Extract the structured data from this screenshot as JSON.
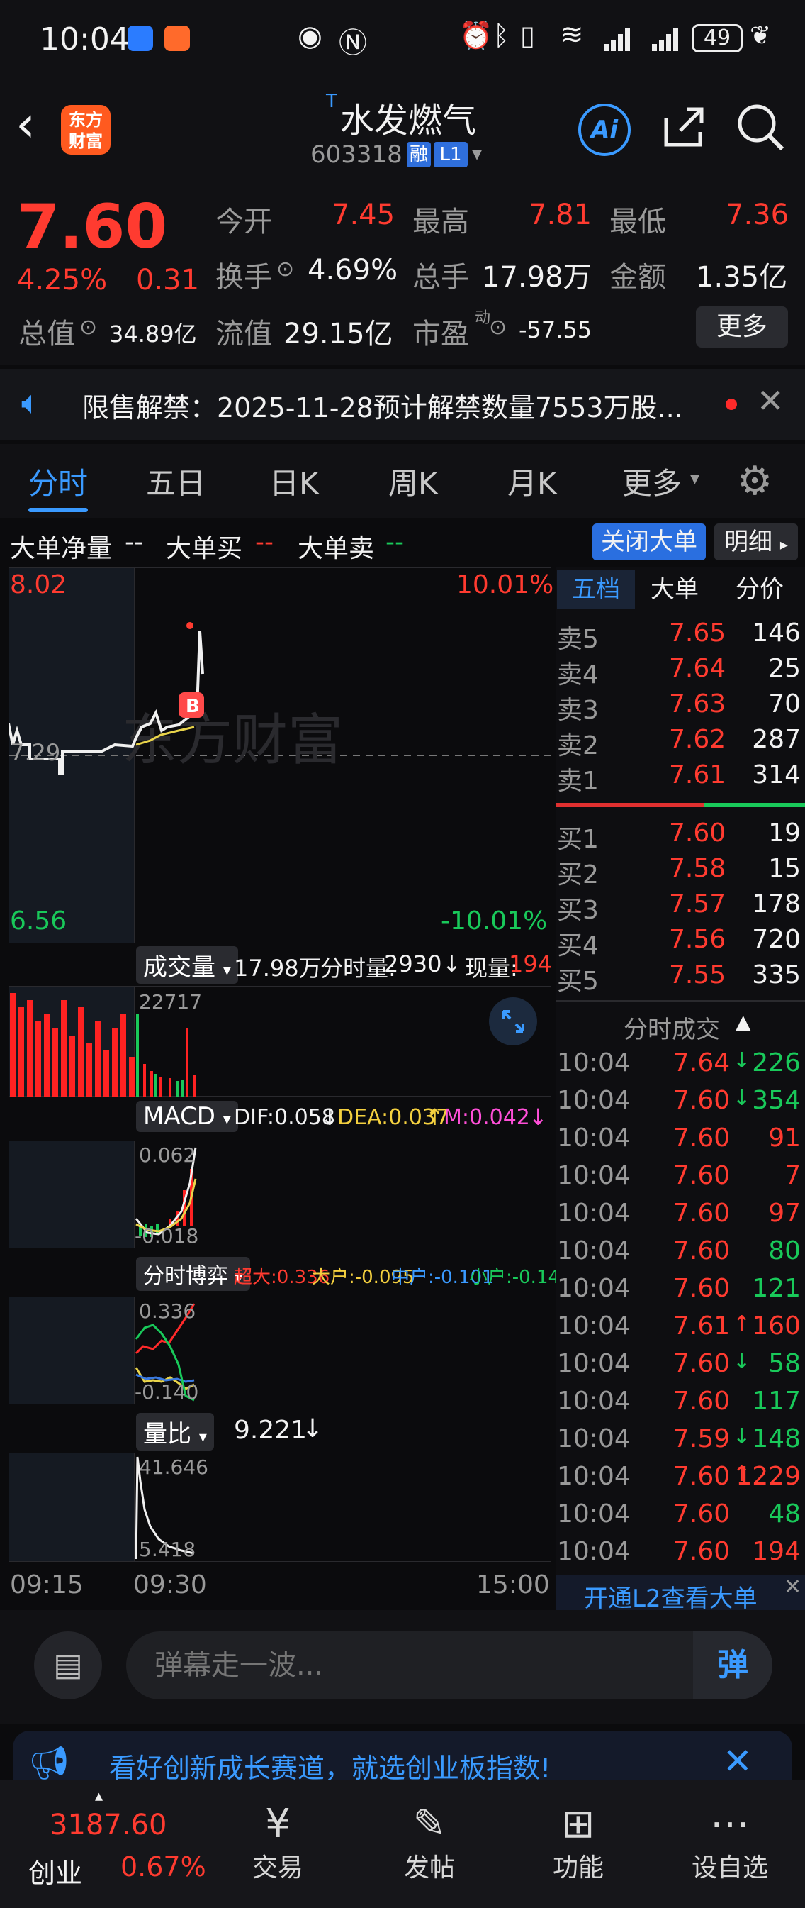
{
  "status_bar": {
    "time": "10:04",
    "battery": "49"
  },
  "header": {
    "logo_line1": "东方",
    "logo_line2": "财富",
    "title_prefix": "T",
    "title": "水发燃气",
    "code": "603318",
    "tag_margin": "融",
    "tag_level": "L1",
    "ai_label": "Ai"
  },
  "quote": {
    "price": "7.60",
    "change_pct": "4.25%",
    "change_amt": "0.31",
    "open_label": "今开",
    "open": "7.45",
    "high_label": "最高",
    "high": "7.81",
    "low_label": "最低",
    "low": "7.36",
    "turnover_label": "换手",
    "turnover": "4.69%",
    "volume_label": "总手",
    "volume": "17.98万",
    "amount_label": "金额",
    "amount": "1.35亿",
    "mktcap_label": "总值",
    "mktcap": "34.89亿",
    "float_label": "流值",
    "float": "29.15亿",
    "pe_label": "市盈",
    "pe_sup": "动",
    "pe": "-57.55",
    "more_button": "更多"
  },
  "notice": {
    "text": "限售解禁：2025-11-28预计解禁数量7553万股..."
  },
  "tabs": [
    {
      "label": "分时",
      "active": true
    },
    {
      "label": "五日",
      "active": false
    },
    {
      "label": "日K",
      "active": false
    },
    {
      "label": "周K",
      "active": false
    },
    {
      "label": "月K",
      "active": false
    },
    {
      "label": "更多",
      "active": false
    }
  ],
  "big_orders": {
    "net_label": "大单净量",
    "net_value": "--",
    "buy_label": "大单买",
    "buy_value": "--",
    "sell_label": "大单卖",
    "sell_value": "--",
    "close_button": "关闭大单",
    "detail_button": "明细"
  },
  "price_chart": {
    "top_price": "8.02",
    "top_pct": "10.01%",
    "mid_price": "7.29",
    "bottom_price": "6.56",
    "bottom_pct": "-10.01%",
    "watermark": "东方财富",
    "marker": "B"
  },
  "volume_panel": {
    "label": "成交量",
    "total": "17.98万",
    "minute_label": "分时量:",
    "minute_value": "2930",
    "now_label": "现量:",
    "now_value": "194",
    "axis_top": "22717"
  },
  "macd_panel": {
    "label": "MACD",
    "dif": "DIF:0.058",
    "dea": "DEA:0.037",
    "m": "M:0.042",
    "axis_top": "0.062",
    "axis_bottom": "-0.018"
  },
  "game_panel": {
    "label": "分时博弈",
    "super": "超大:0.336",
    "big": "大户:-0.095",
    "mid": "中户:-0.101",
    "small": "小户:-0.140",
    "axis_top": "0.336",
    "axis_bottom": "-0.140"
  },
  "ratio_panel": {
    "label": "量比",
    "value": "9.221",
    "axis_top": "41.646",
    "axis_bottom": "5.418"
  },
  "time_axis": {
    "start": "09:15",
    "mid": "09:30",
    "end": "15:00"
  },
  "orderbook": {
    "tabs": [
      "五档",
      "大单",
      "分价"
    ],
    "sells": [
      {
        "label": "卖5",
        "price": "7.65",
        "vol": "146"
      },
      {
        "label": "卖4",
        "price": "7.64",
        "vol": "25"
      },
      {
        "label": "卖3",
        "price": "7.63",
        "vol": "70"
      },
      {
        "label": "卖2",
        "price": "7.62",
        "vol": "287"
      },
      {
        "label": "卖1",
        "price": "7.61",
        "vol": "314"
      }
    ],
    "buys": [
      {
        "label": "买1",
        "price": "7.60",
        "vol": "19"
      },
      {
        "label": "买2",
        "price": "7.58",
        "vol": "15"
      },
      {
        "label": "买3",
        "price": "7.57",
        "vol": "178"
      },
      {
        "label": "买4",
        "price": "7.56",
        "vol": "720"
      },
      {
        "label": "买5",
        "price": "7.55",
        "vol": "335"
      }
    ]
  },
  "trades": {
    "title": "分时成交",
    "rows": [
      {
        "time": "10:04",
        "price": "7.64",
        "arrow": "↓",
        "vol": "226",
        "color": "green"
      },
      {
        "time": "10:04",
        "price": "7.60",
        "arrow": "↓",
        "vol": "354",
        "color": "green"
      },
      {
        "time": "10:04",
        "price": "7.60",
        "arrow": "",
        "vol": "91",
        "color": "red"
      },
      {
        "time": "10:04",
        "price": "7.60",
        "arrow": "",
        "vol": "7",
        "color": "red"
      },
      {
        "time": "10:04",
        "price": "7.60",
        "arrow": "",
        "vol": "97",
        "color": "red"
      },
      {
        "time": "10:04",
        "price": "7.60",
        "arrow": "",
        "vol": "80",
        "color": "green"
      },
      {
        "time": "10:04",
        "price": "7.60",
        "arrow": "",
        "vol": "121",
        "color": "green"
      },
      {
        "time": "10:04",
        "price": "7.61",
        "arrow": "↑",
        "vol": "160",
        "color": "red"
      },
      {
        "time": "10:04",
        "price": "7.60",
        "arrow": "↓",
        "vol": "58",
        "color": "green"
      },
      {
        "time": "10:04",
        "price": "7.60",
        "arrow": "",
        "vol": "117",
        "color": "green"
      },
      {
        "time": "10:04",
        "price": "7.59",
        "arrow": "↓",
        "vol": "148",
        "color": "green"
      },
      {
        "time": "10:04",
        "price": "7.60",
        "arrow": "↑",
        "vol": "1229",
        "color": "red"
      },
      {
        "time": "10:04",
        "price": "7.60",
        "arrow": "",
        "vol": "48",
        "color": "green"
      },
      {
        "time": "10:04",
        "price": "7.60",
        "arrow": "",
        "vol": "194",
        "color": "red"
      }
    ],
    "l2_link": "开通L2查看大单"
  },
  "input": {
    "placeholder": "弹幕走一波...",
    "send_label": "弹"
  },
  "banner": {
    "text": "看好创新成长赛道，就选创业板指数!"
  },
  "bottom_nav": {
    "index_value": "3187.60",
    "index_name": "创业",
    "index_pct": "0.67%",
    "items": [
      "交易",
      "发帖",
      "功能",
      "设自选"
    ]
  }
}
